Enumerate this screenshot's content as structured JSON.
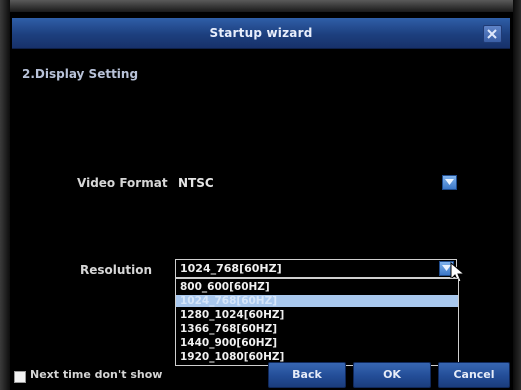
{
  "window": {
    "title": "Startup wizard",
    "close_icon": "close-icon"
  },
  "step": {
    "heading": "2.Display Setting"
  },
  "video_format": {
    "label": "Video Format",
    "value": "NTSC"
  },
  "resolution": {
    "label": "Resolution",
    "value": "1024_768[60HZ]",
    "options": [
      "800_600[60HZ]",
      "1024_768[60HZ]",
      "1280_1024[60HZ]",
      "1366_768[60HZ]",
      "1440_900[60HZ]",
      "1920_1080[60HZ]"
    ],
    "highlighted_option_index": 1
  },
  "footer": {
    "checkbox_label": "Next time don't show",
    "checkbox_checked": false,
    "back_label": "Back",
    "ok_label": "OK",
    "cancel_label": "Cancel"
  },
  "colors": {
    "titlebar": "#1d3f7e",
    "button": "#234d97",
    "highlight": "#a9c8ee",
    "background": "#000000"
  }
}
